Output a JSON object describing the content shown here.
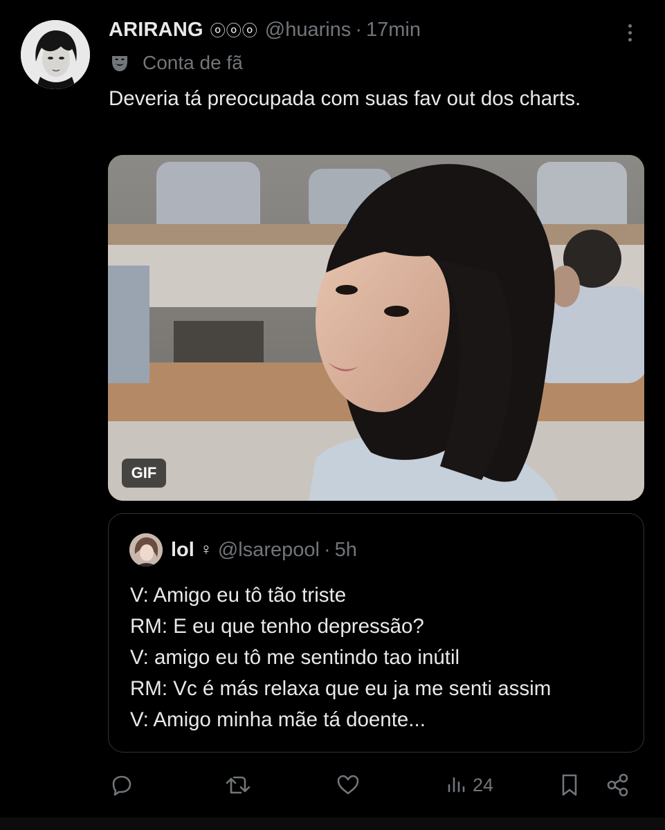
{
  "post": {
    "author": {
      "display_name": "ARIRANG",
      "name_emoji": "ⓞⓞⓞ",
      "handle": "@huarins",
      "time": "17min",
      "label": "Conta de fã"
    },
    "text": "Deveria tá preocupada com suas fav out dos charts.",
    "media": {
      "badge": "GIF"
    },
    "quote": {
      "display_name": "lol",
      "name_emoji": "♀",
      "handle": "@lsarepool",
      "time": "5h",
      "lines": [
        "V: Amigo eu tô tão triste",
        "RM: E eu que tenho depressão?",
        "V: amigo eu tô me sentindo tao inútil",
        "RM: Vc é más relaxa que eu ja me senti assim",
        "V: Amigo minha mãe tá doente..."
      ]
    },
    "actions": {
      "views": "24"
    },
    "separator": "·"
  },
  "colors": {
    "background": "#000000",
    "text": "#e7e9ea",
    "muted": "#71767b",
    "border": "#2f3336"
  }
}
